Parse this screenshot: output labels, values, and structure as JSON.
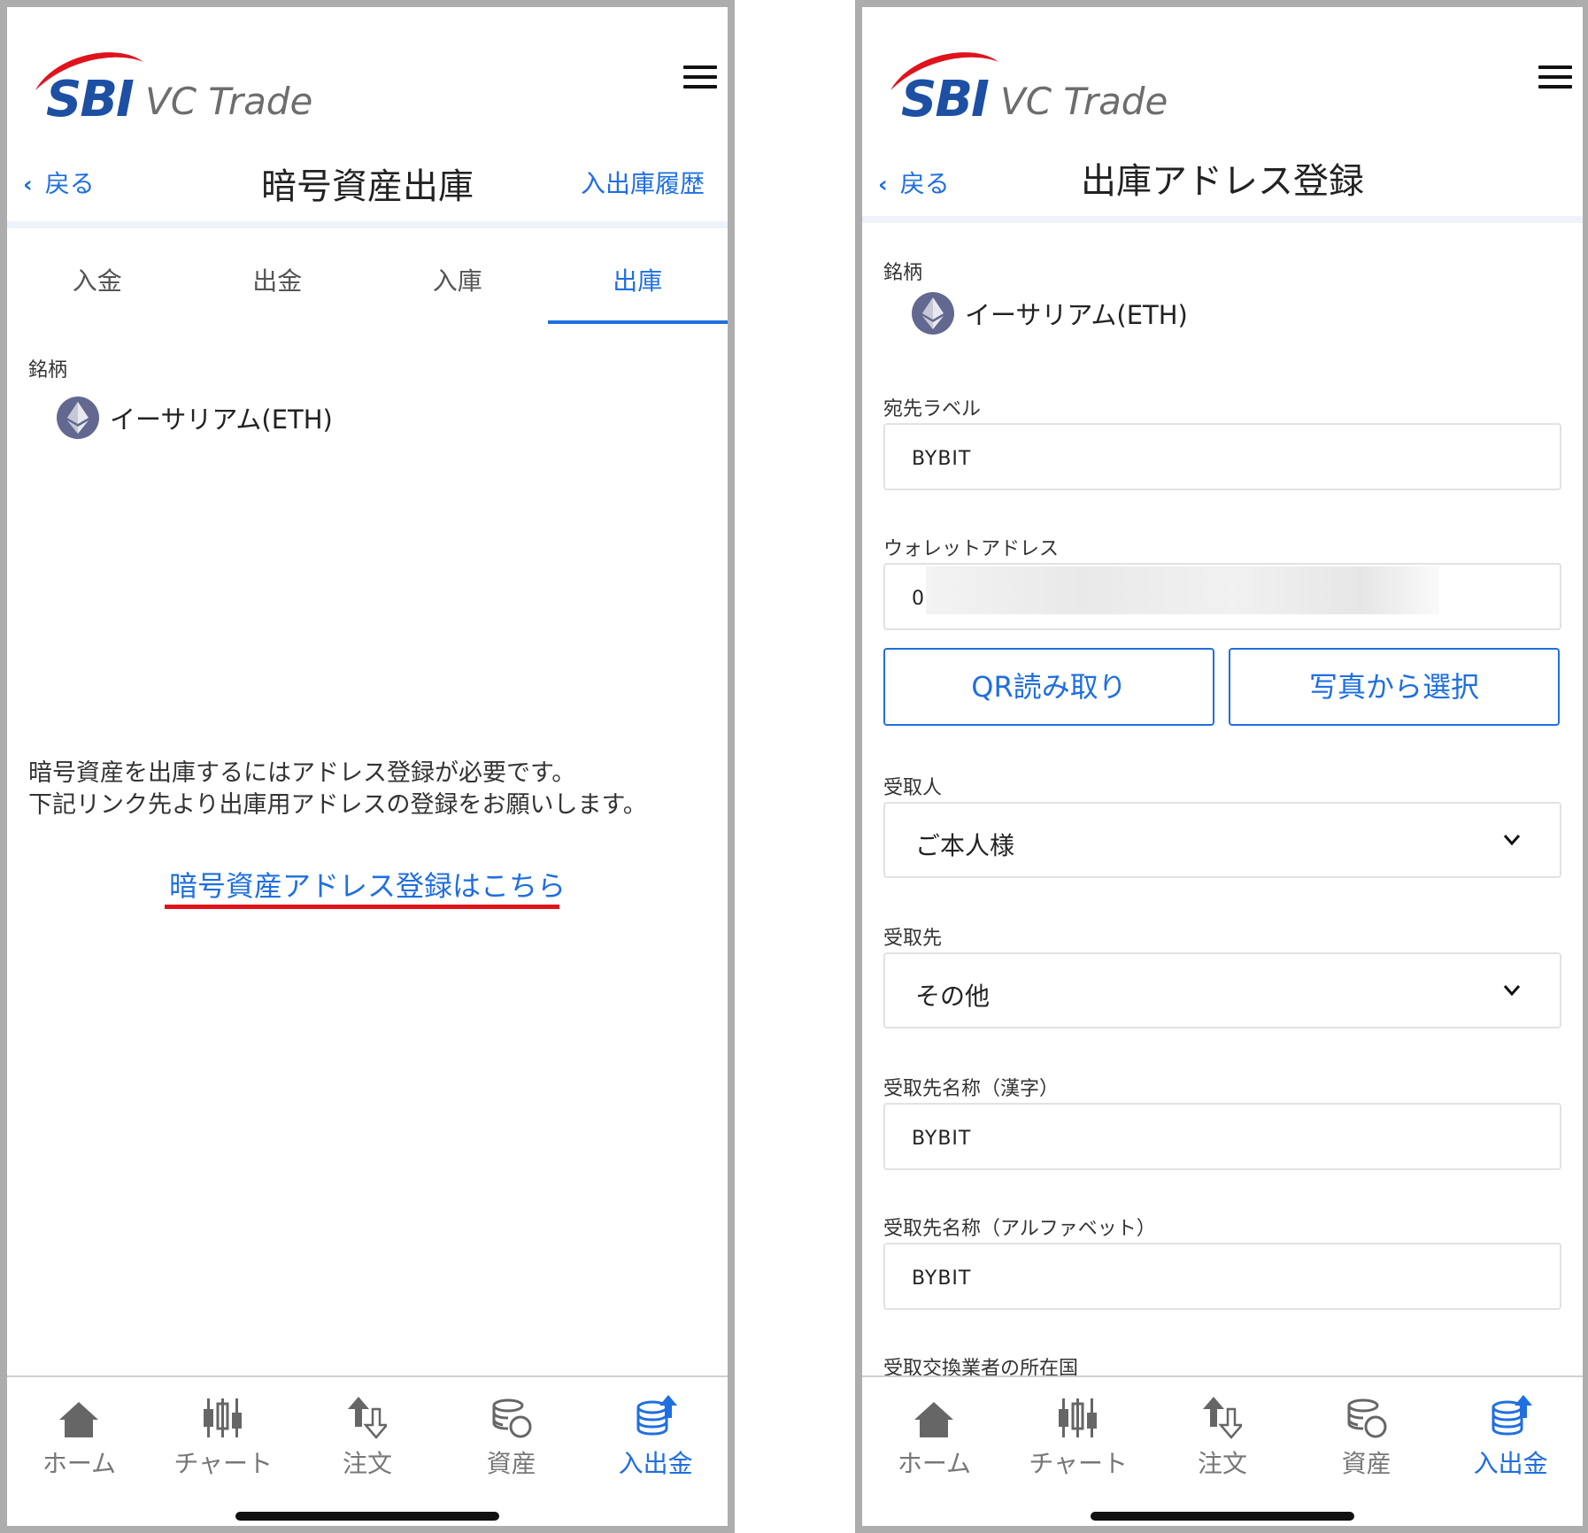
{
  "logo": {
    "brand": "SBI",
    "product": "VC Trade"
  },
  "left": {
    "back_label": "戻る",
    "title": "暗号資産出庫",
    "history_link": "入出庫履歴",
    "tabs": [
      "入金",
      "出金",
      "入庫",
      "出庫"
    ],
    "active_tab": "出庫",
    "coin_label": "銘柄",
    "coin_name": "イーサリアム(ETH)",
    "notice_line1": "暗号資産を出庫するにはアドレス登録が必要です。",
    "notice_line2": "下記リンク先より出庫用アドレスの登録をお願いします。",
    "register_link": "暗号資産アドレス登録はこちら"
  },
  "right": {
    "back_label": "戻る",
    "title": "出庫アドレス登録",
    "coin_label": "銘柄",
    "coin_name": "イーサリアム(ETH)",
    "dest_label_label": "宛先ラベル",
    "dest_label_value": "BYBIT",
    "wallet_label": "ウォレットアドレス",
    "wallet_value": "0",
    "qr_button": "QR読み取り",
    "photo_button": "写真から選択",
    "recipient_label": "受取人",
    "recipient_value": "ご本人様",
    "destination_label": "受取先",
    "destination_value": "その他",
    "name_kanji_label": "受取先名称（漢字）",
    "name_kanji_value": "BYBIT",
    "name_alpha_label": "受取先名称（アルファベット）",
    "name_alpha_value": "BYBIT",
    "exchange_country_label": "受取交換業者の所在国"
  },
  "nav": {
    "items": [
      "ホーム",
      "チャート",
      "注文",
      "資産",
      "入出金"
    ],
    "active": "入出金"
  },
  "colors": {
    "accent": "#1f6fe0",
    "brand": "#1d4fa3",
    "underline": "#e0131c"
  }
}
